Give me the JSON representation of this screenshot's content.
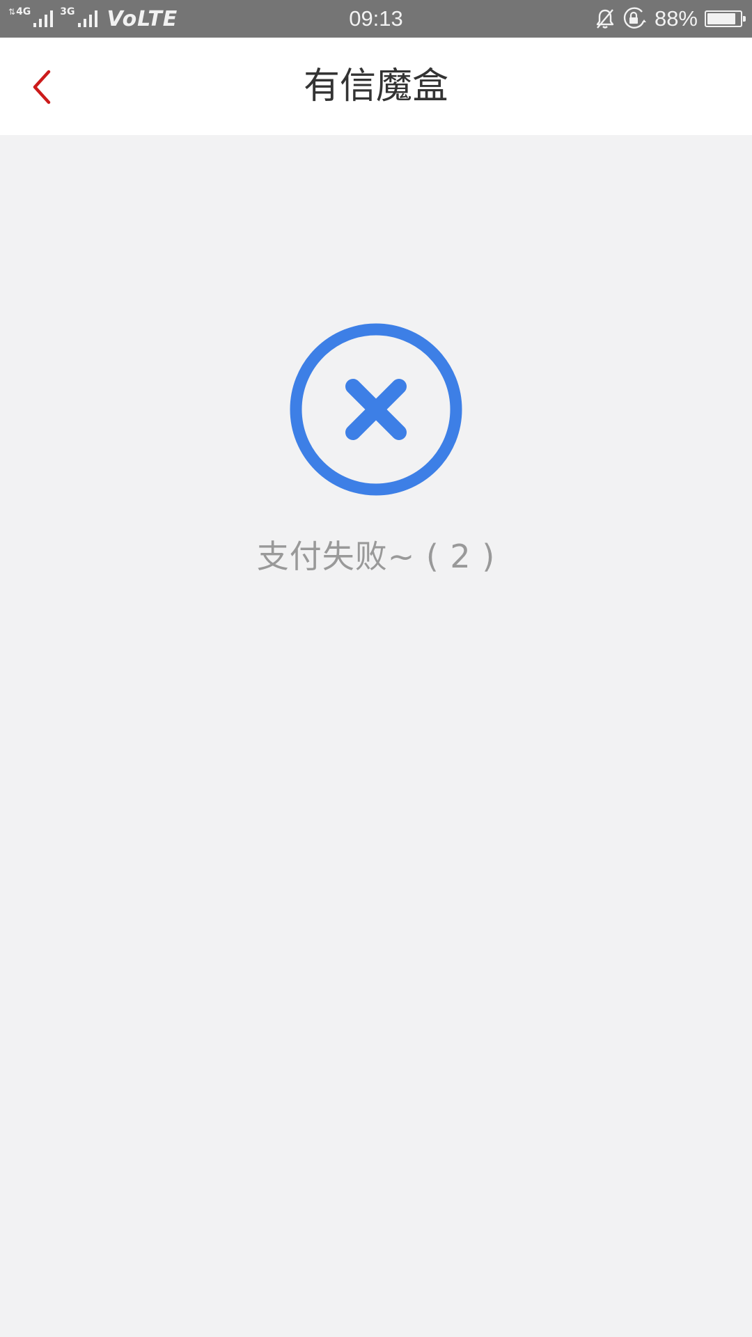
{
  "status_bar": {
    "network_4g": "4G",
    "network_3g": "3G",
    "volte": "VoLTE",
    "time": "09:13",
    "battery_percent": "88%",
    "battery_level": 0.88,
    "icons": [
      "data-arrows-icon",
      "signal-icon",
      "mute-icon",
      "rotation-lock-icon",
      "battery-icon"
    ]
  },
  "nav": {
    "title": "有信魔盒",
    "back_icon": "chevron-left-icon",
    "back_color": "#cc1b1b"
  },
  "result": {
    "icon": "close-circle-icon",
    "icon_color": "#3d7fe6",
    "message": "支付失败~ ( 2 )"
  }
}
